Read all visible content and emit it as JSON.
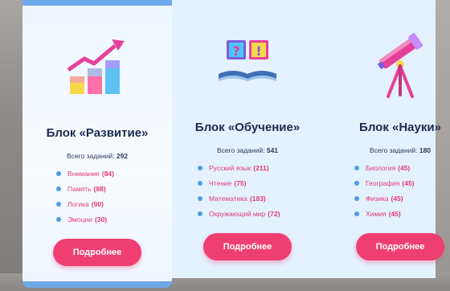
{
  "cards": [
    {
      "title": "Блок «Развитие»",
      "total_label": "Всего заданий:",
      "total_value": "292",
      "items": [
        {
          "label": "Внимание",
          "count": "(84)"
        },
        {
          "label": "Память",
          "count": "(88)"
        },
        {
          "label": "Логика",
          "count": "(90)"
        },
        {
          "label": "Эмоции",
          "count": "(30)"
        }
      ],
      "button": "Подробнее",
      "icon": "growth-chart-icon"
    },
    {
      "title": "Блок «Обучение»",
      "total_label": "Всего заданий:",
      "total_value": "541",
      "items": [
        {
          "label": "Русский язык",
          "count": "(211)"
        },
        {
          "label": "Чтение",
          "count": "(75)"
        },
        {
          "label": "Математика",
          "count": "(183)"
        },
        {
          "label": "Окружающий мир",
          "count": "(72)"
        }
      ],
      "button": "Подробнее",
      "icon": "book-quiz-icon"
    },
    {
      "title": "Блок «Науки»",
      "total_label": "Всего заданий:",
      "total_value": "180",
      "items": [
        {
          "label": "Биология",
          "count": "(45)"
        },
        {
          "label": "География",
          "count": "(45)"
        },
        {
          "label": "Физика",
          "count": "(45)"
        },
        {
          "label": "Химия",
          "count": "(45)"
        }
      ],
      "button": "Подробнее",
      "icon": "telescope-icon"
    }
  ],
  "colors": {
    "accent": "#ef3f72",
    "bullet": "#4aa0e6",
    "title": "#1b2c4d",
    "panel": "#e4f1ff",
    "featured_border": "#6ea8e8"
  }
}
